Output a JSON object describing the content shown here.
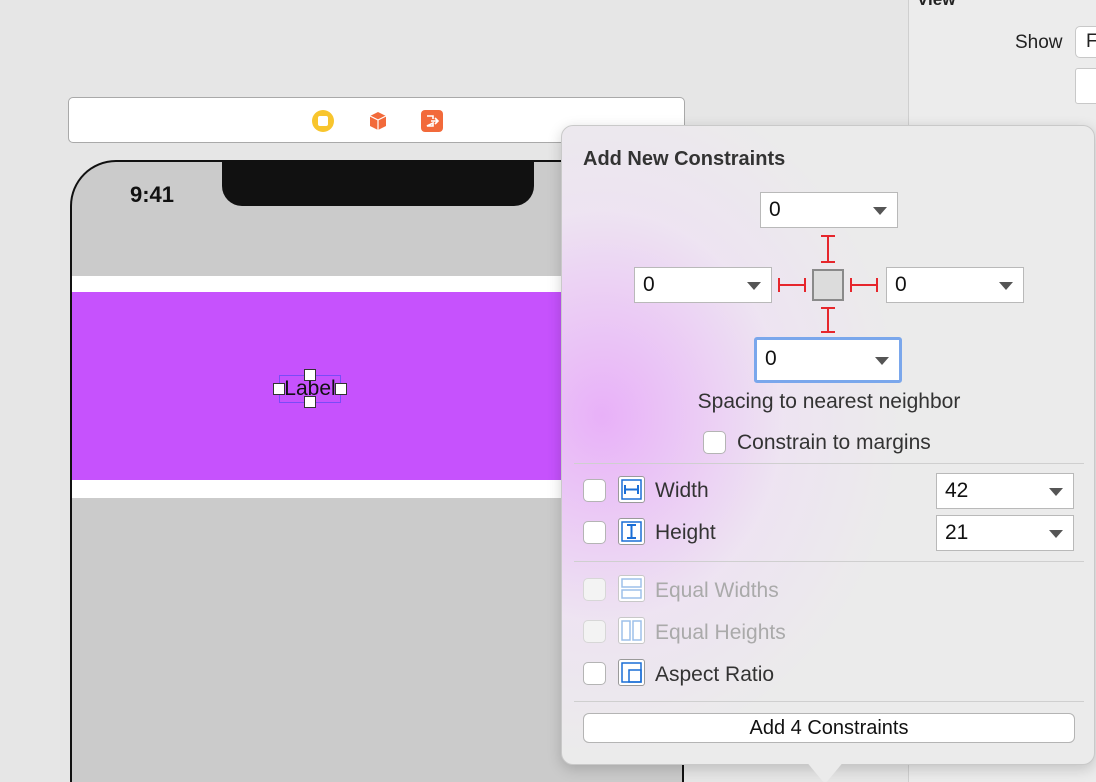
{
  "inspector": {
    "section_title": "View",
    "show_label": "Show",
    "show_value": "F"
  },
  "device": {
    "status_time": "9:41",
    "label_text": "Label"
  },
  "popover": {
    "title": "Add New Constraints",
    "top_value": "0",
    "left_value": "0",
    "right_value": "0",
    "bottom_value": "0",
    "spacing_label": "Spacing to nearest neighbor",
    "constrain_margins_label": "Constrain to margins",
    "width_label": "Width",
    "width_value": "42",
    "height_label": "Height",
    "height_value": "21",
    "equal_widths_label": "Equal Widths",
    "equal_heights_label": "Equal Heights",
    "aspect_ratio_label": "Aspect Ratio",
    "add_button_label": "Add 4 Constraints"
  },
  "colors": {
    "accent_purple": "#c652fd",
    "strut_red": "#e6262c",
    "icon_blue": "#1a6ed6",
    "focus_ring": "#7aa7ec"
  }
}
